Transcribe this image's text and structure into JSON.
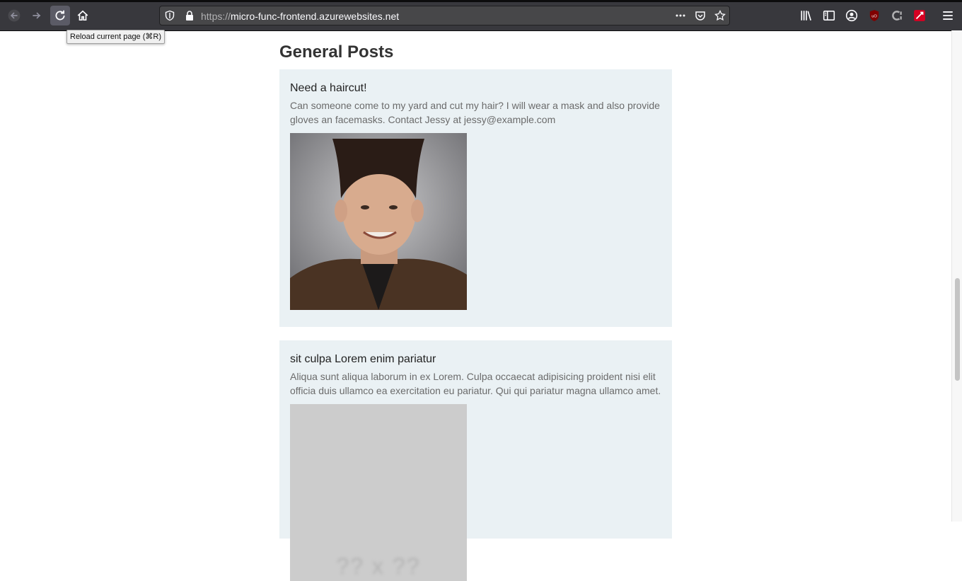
{
  "browser": {
    "url_scheme": "https://",
    "url_host": "micro-func-frontend.azurewebsites.net",
    "tooltip": "Reload current page (⌘R)",
    "icons": [
      "back-icon",
      "forward-icon",
      "reload-icon",
      "home-icon",
      "shield-icon",
      "lock-icon",
      "more-icon",
      "pocket-icon",
      "star-icon",
      "library-icon",
      "sidebar-icon",
      "account-icon",
      "ublock-icon",
      "extension-c-icon",
      "extension-red-icon",
      "menu-icon"
    ]
  },
  "page": {
    "title": "General Posts",
    "posts": [
      {
        "title": "Need a haircut!",
        "body": "Can someone come to my yard and cut my hair? I will wear a mask and also provide gloves an facemasks. Contact Jessy at jessy@example.com"
      },
      {
        "title": "sit culpa Lorem enim pariatur",
        "body": "Aliqua sunt aliqua laborum in ex Lorem. Culpa occaecat adipisicing proident nisi elit officia duis ullamco ea exercitation eu pariatur. Qui qui pariatur magna ullamco amet.",
        "image_text": "?? x ??"
      }
    ]
  }
}
